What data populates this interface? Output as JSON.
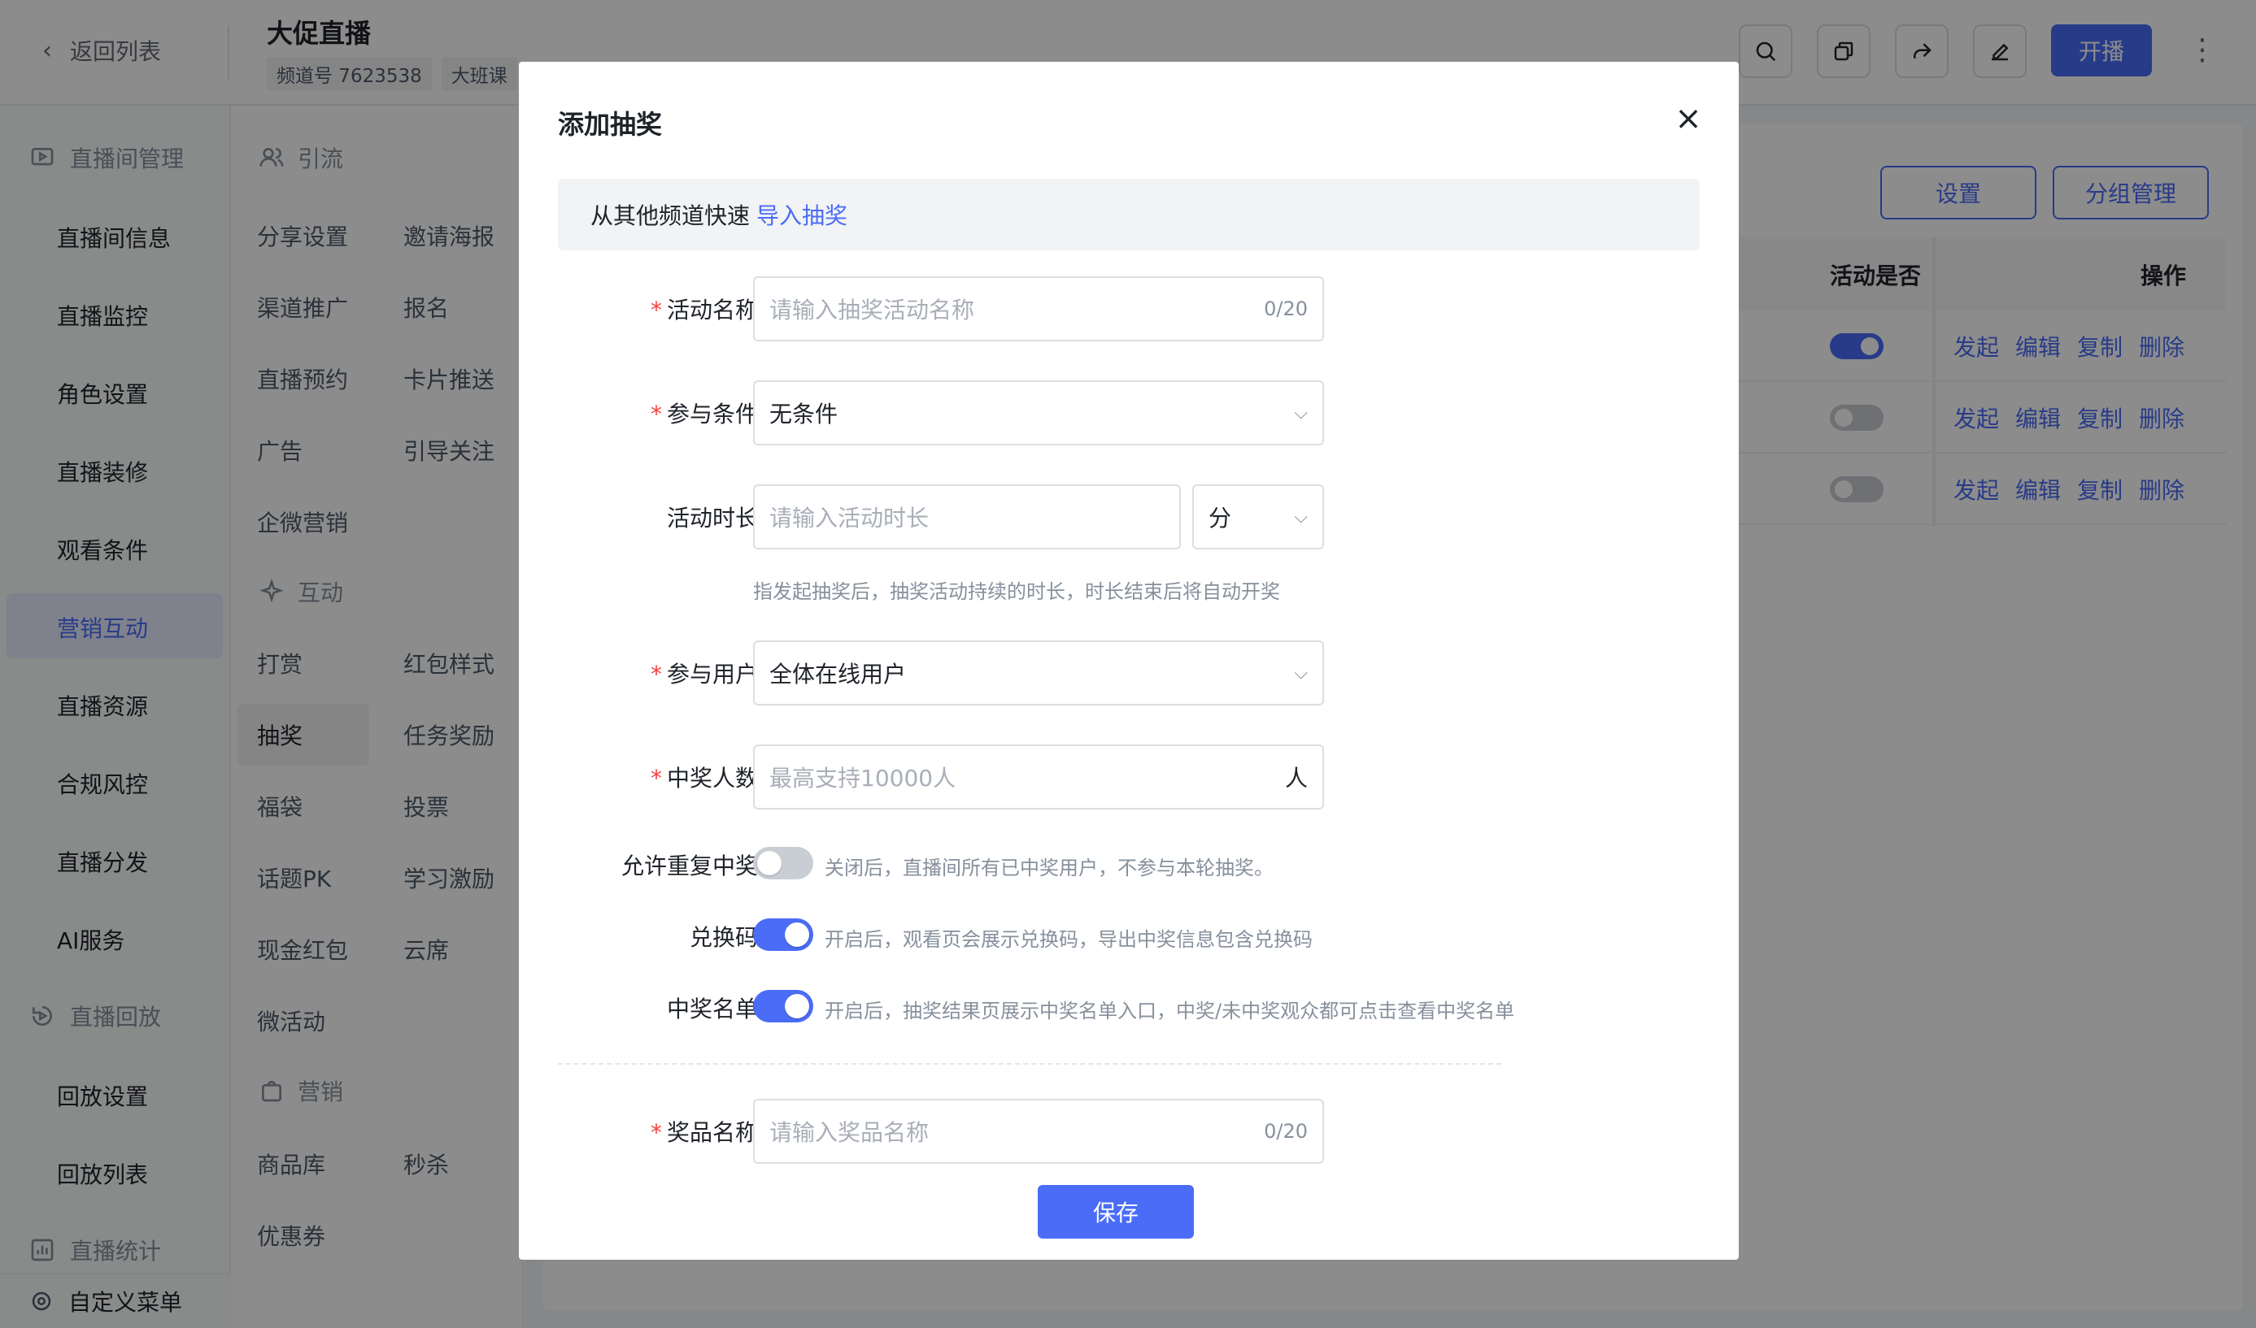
{
  "header": {
    "back_label": "返回列表",
    "channel_title": "大促直播",
    "tags": [
      "频道号 7623538",
      "大班课"
    ],
    "start_label": "开播"
  },
  "sidebar": {
    "group_live": "直播间管理",
    "items": [
      "直播间信息",
      "直播监控",
      "角色设置",
      "直播装修",
      "观看条件",
      "营销互动",
      "直播资源",
      "合规风控",
      "直播分发",
      "AI服务"
    ],
    "group_playback": "直播回放",
    "playback_items": [
      "回放设置",
      "回放列表"
    ],
    "group_stats": "直播统计",
    "footer": "自定义菜单"
  },
  "subnav": {
    "group_traffic": "引流",
    "traffic_items": [
      "分享设置",
      "邀请海报",
      "渠道推广",
      "报名",
      "直播预约",
      "卡片推送",
      "广告",
      "引导关注",
      "企微营销"
    ],
    "group_interact": "互动",
    "interact_items": [
      "打赏",
      "红包样式",
      "抽奖",
      "任务奖励",
      "福袋",
      "投票",
      "话题PK",
      "学习激励",
      "现金红包",
      "云席",
      "微活动"
    ],
    "group_marketing": "营销",
    "marketing_items": [
      "商品库",
      "秒杀",
      "优惠券"
    ]
  },
  "main": {
    "settings_btn": "设置",
    "group_btn": "分组管理",
    "col_active": "活动是否",
    "col_ops": "操作",
    "rows": [
      {
        "active": true,
        "ops": [
          "发起",
          "编辑",
          "复制",
          "删除"
        ]
      },
      {
        "active": false,
        "ops": [
          "发起",
          "编辑",
          "复制",
          "删除"
        ]
      },
      {
        "active": false,
        "ops": [
          "发起",
          "编辑",
          "复制",
          "删除"
        ]
      }
    ]
  },
  "modal": {
    "title": "添加抽奖",
    "close": "×",
    "import_text": "从其他频道快速",
    "import_link": "导入抽奖",
    "activity_name": {
      "label": "活动名称",
      "placeholder": "请输入抽奖活动名称",
      "count": "0/20"
    },
    "condition": {
      "label": "参与条件",
      "value": "无条件"
    },
    "duration": {
      "label": "活动时长",
      "placeholder": "请输入活动时长",
      "unit": "分",
      "tip": "指发起抽奖后，抽奖活动持续的时长，时长结束后将自动开奖"
    },
    "users": {
      "label": "参与用户",
      "value": "全体在线用户"
    },
    "winners": {
      "label": "中奖人数",
      "placeholder": "最高支持10000人",
      "suffix": "人"
    },
    "repeat": {
      "label": "允许重复中奖",
      "on": false,
      "tip": "关闭后，直播间所有已中奖用户，不参与本轮抽奖。"
    },
    "code": {
      "label": "兑换码",
      "on": true,
      "tip": "开启后，观看页会展示兑换码，导出中奖信息包含兑换码"
    },
    "list": {
      "label": "中奖名单",
      "on": true,
      "tip": "开启后，抽奖结果页展示中奖名单入口，中奖/未中奖观众都可点击查看中奖名单"
    },
    "prize_name": {
      "label": "奖品名称",
      "placeholder": "请输入奖品名称",
      "count": "0/20"
    },
    "save": "保存"
  },
  "colors": {
    "primary": "#4a6cf7",
    "required": "#f53f3f",
    "mask": "rgba(0,0,0,0.45)"
  }
}
